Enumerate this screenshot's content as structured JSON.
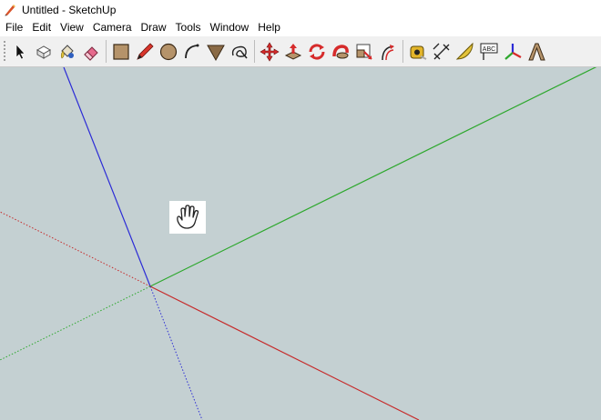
{
  "window": {
    "title": "Untitled - SketchUp"
  },
  "menu": [
    "File",
    "Edit",
    "View",
    "Camera",
    "Draw",
    "Tools",
    "Window",
    "Help"
  ],
  "colors": {
    "viewport_bg": "#c4d0d2",
    "red_axis": "#c62b2b",
    "green_axis": "#2ea82e",
    "blue_axis": "#2b2bd6"
  },
  "toolbar": {
    "groups": [
      [
        "select-tool-icon",
        "make-component-icon",
        "paint-bucket-icon",
        "eraser-icon"
      ],
      [
        "rectangle-icon",
        "pencil-line-icon",
        "circle-icon",
        "arc-icon",
        "polygon-icon",
        "freehand-icon"
      ],
      [
        "move-icon",
        "push-pull-icon",
        "rotate-icon",
        "follow-me-icon",
        "scale-icon",
        "offset-icon"
      ],
      [
        "tape-measure-icon",
        "dimension-icon",
        "protractor-icon",
        "text-label-icon",
        "axes-icon",
        "3d-text-icon"
      ]
    ],
    "text_label_glyph": "ABC"
  },
  "viewport": {
    "cursor": "pan-hand-icon"
  }
}
